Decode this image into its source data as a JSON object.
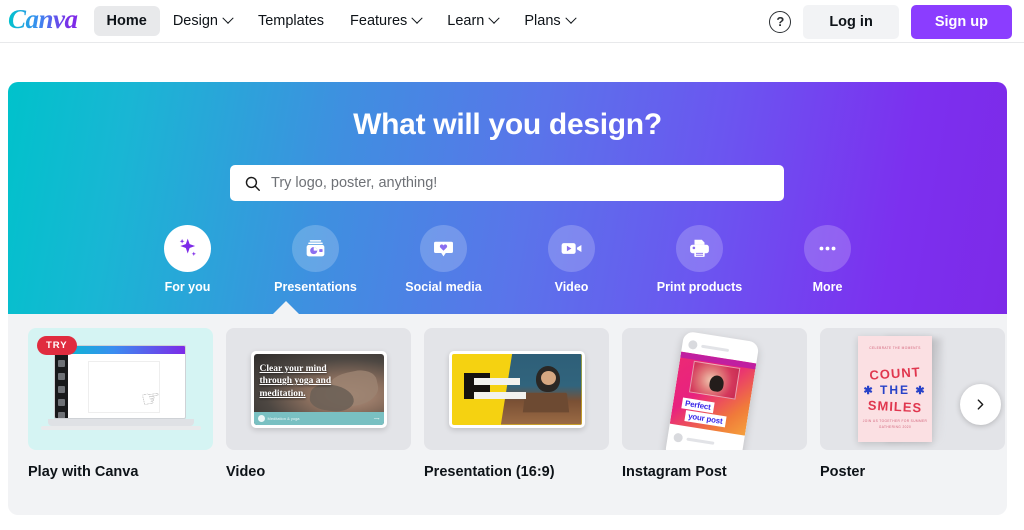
{
  "header": {
    "logo": "Canva",
    "nav": [
      {
        "label": "Home",
        "icon": null,
        "active": true,
        "has_caret": false
      },
      {
        "label": "Design",
        "icon": "chevron-down-icon",
        "active": false,
        "has_caret": true
      },
      {
        "label": "Templates",
        "icon": null,
        "active": false,
        "has_caret": false
      },
      {
        "label": "Features",
        "icon": "chevron-down-icon",
        "active": false,
        "has_caret": true
      },
      {
        "label": "Learn",
        "icon": "chevron-down-icon",
        "active": false,
        "has_caret": true
      },
      {
        "label": "Plans",
        "icon": "chevron-down-icon",
        "active": false,
        "has_caret": true
      }
    ],
    "help_icon": "help-circle-icon",
    "help_glyph": "?",
    "login_label": "Log in",
    "signup_label": "Sign up"
  },
  "hero": {
    "title": "What will you design?",
    "search": {
      "icon": "search-icon",
      "value": "",
      "placeholder": "Try logo, poster, anything!"
    },
    "categories": [
      {
        "label": "For you",
        "icon": "sparkle-icon",
        "active": true
      },
      {
        "label": "Presentations",
        "icon": "projector-icon",
        "active": false
      },
      {
        "label": "Social media",
        "icon": "heart-bubble-icon",
        "active": false
      },
      {
        "label": "Video",
        "icon": "video-camera-icon",
        "active": false
      },
      {
        "label": "Print products",
        "icon": "printer-icon",
        "active": false
      },
      {
        "label": "More",
        "icon": "ellipsis-icon",
        "active": false
      }
    ]
  },
  "content": {
    "cards": [
      {
        "label": "Play with Canva",
        "badge": "TRY",
        "thumb_class": "t1",
        "thumb_alt": "laptop-editor-illustration"
      },
      {
        "label": "Video",
        "badge": null,
        "thumb_class": "t2",
        "thumb_alt": "yoga-video-thumbnail",
        "art_text": "Clear your mind through yoga and meditation.",
        "art_caption": "Meditation & yoga"
      },
      {
        "label": "Presentation (16:9)",
        "badge": null,
        "thumb_class": "t3",
        "thumb_alt": "yellow-presentation-thumbnail"
      },
      {
        "label": "Instagram Post",
        "badge": null,
        "thumb_class": "t4",
        "thumb_alt": "phone-instagram-post-thumbnail",
        "art_text_1": "Perfect",
        "art_text_2": "your post"
      },
      {
        "label": "Poster",
        "badge": null,
        "thumb_class": "t5",
        "thumb_alt": "count-the-smiles-poster-thumbnail",
        "poster_top": "CELEBRATE THE MOMENTS",
        "poster_line1": "COUNT",
        "poster_line2": "THE",
        "poster_line3": "SMILES",
        "poster_bottom": "JOIN US TOGETHER FOR SUMMER\nGATHERING 2020"
      }
    ],
    "next_button": "chevron-right-icon"
  },
  "colors": {
    "brand_purple": "#8b3dff",
    "gradient_start": "#00c2cb",
    "gradient_end": "#7d2ae8",
    "badge_red": "#e02c3f",
    "content_bg": "#f2f3f5"
  }
}
